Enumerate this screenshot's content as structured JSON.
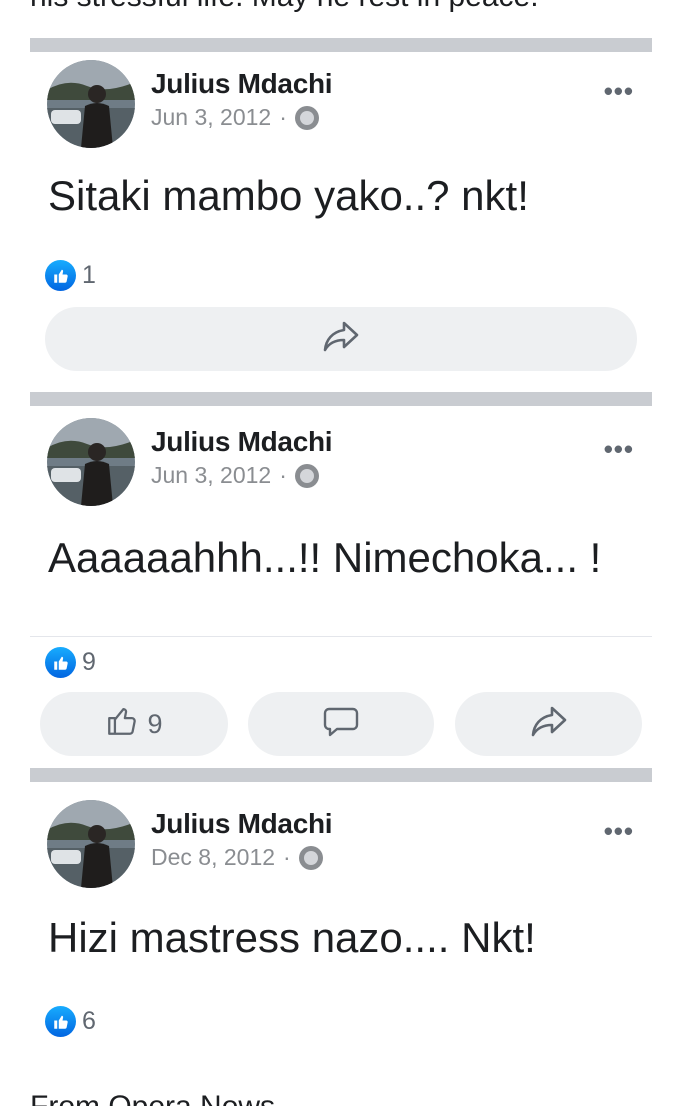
{
  "context": {
    "top_text": "his stressful life. May he rest in peace.",
    "bottom_text": "From Opera News"
  },
  "posts": [
    {
      "author": "Julius Mdachi",
      "date": "Jun 3, 2012",
      "separator": "·",
      "text": "Sitaki mambo yako..? nkt!",
      "like_count": "1",
      "buttons": {
        "share": "share-icon"
      }
    },
    {
      "author": "Julius Mdachi",
      "date": "Jun 3, 2012",
      "separator": "·",
      "text": "Aaaaaahhh...!! Nimechoka... !",
      "like_count": "9",
      "buttons": {
        "like_count": "9",
        "like": "thumbs-up-icon",
        "comment": "comment-icon",
        "share": "share-icon"
      }
    },
    {
      "author": "Julius Mdachi",
      "date": "Dec 8, 2012",
      "separator": "·",
      "text": "Hizi mastress nazo.... Nkt!",
      "like_count": "6"
    }
  ],
  "more_label": "•••",
  "colors": {
    "like_blue": "#0866ff",
    "separator": "#c9ccd1",
    "button_bg": "#eef0f2",
    "meta_gray": "#8a8d91"
  }
}
